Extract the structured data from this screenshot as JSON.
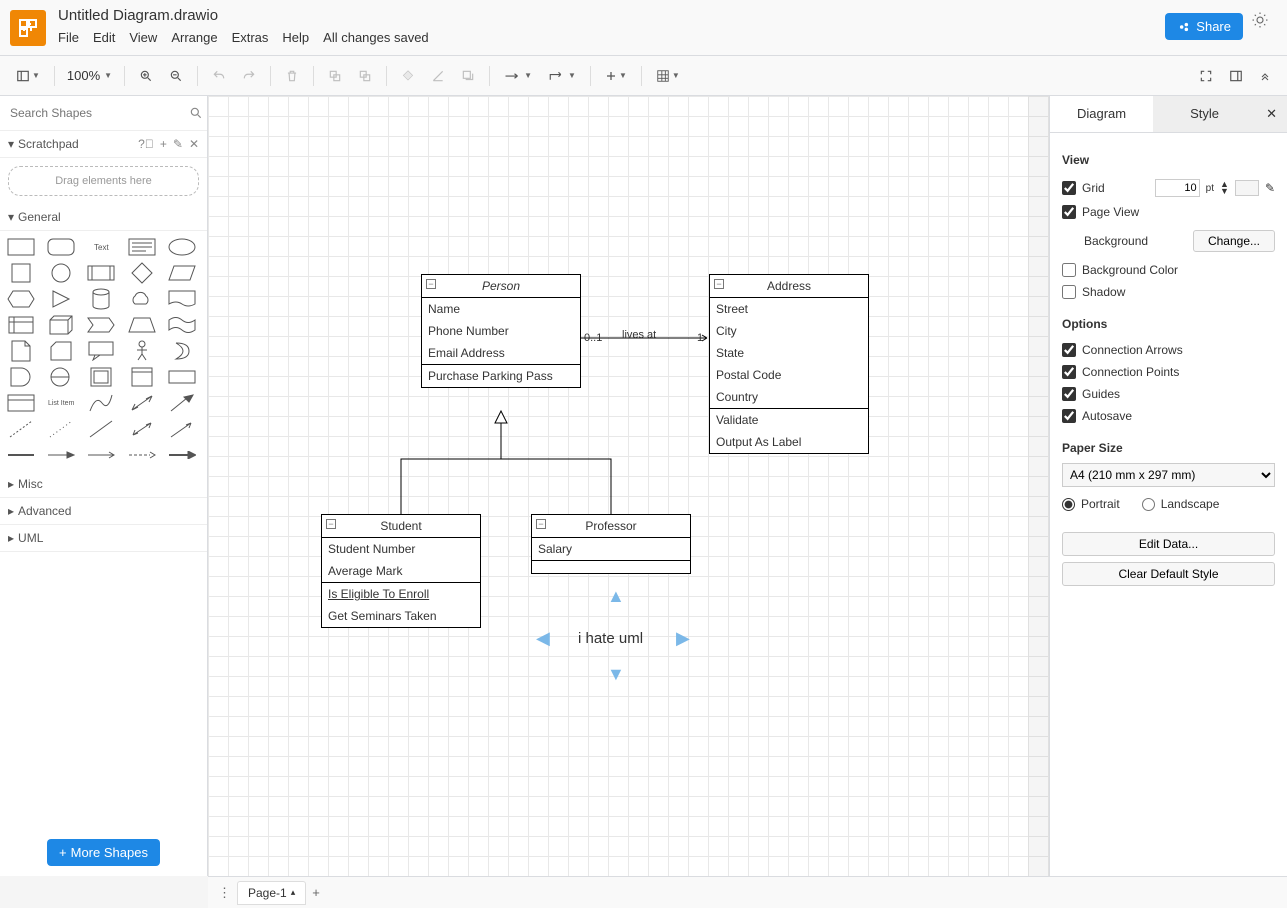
{
  "doc_title": "Untitled Diagram.drawio",
  "menu": [
    "File",
    "Edit",
    "View",
    "Arrange",
    "Extras",
    "Help"
  ],
  "save_status": "All changes saved",
  "share": "Share",
  "zoom": "100%",
  "search_placeholder": "Search Shapes",
  "scratchpad": {
    "label": "Scratchpad",
    "dropzone": "Drag elements here"
  },
  "sections": {
    "general": "General",
    "misc": "Misc",
    "advanced": "Advanced",
    "uml": "UML"
  },
  "more_shapes": "More Shapes",
  "page_tab": "Page-1",
  "uml": {
    "person": {
      "title": "Person",
      "attrs": [
        "Name",
        "Phone Number",
        "Email Address"
      ],
      "ops": [
        "Purchase Parking Pass"
      ]
    },
    "address": {
      "title": "Address",
      "attrs": [
        "Street",
        "City",
        "State",
        "Postal Code",
        "Country"
      ],
      "ops": [
        "Validate",
        "Output As Label"
      ]
    },
    "student": {
      "title": "Student",
      "attrs": [
        "Student Number",
        "Average Mark"
      ],
      "ops": [
        "Is Eligible To Enroll",
        "Get Seminars Taken"
      ]
    },
    "professor": {
      "title": "Professor",
      "attrs": [
        "Salary"
      ]
    },
    "assoc": {
      "label": "lives at",
      "left": "0..1",
      "right": "1"
    },
    "free_text": "i hate uml"
  },
  "panel": {
    "tabs": {
      "diagram": "Diagram",
      "style": "Style"
    },
    "view": {
      "title": "View",
      "grid": "Grid",
      "grid_val": "10",
      "grid_unit": "pt",
      "page_view": "Page View",
      "background": "Background",
      "change": "Change...",
      "bg_color": "Background Color",
      "shadow": "Shadow"
    },
    "options": {
      "title": "Options",
      "conn_arrows": "Connection Arrows",
      "conn_points": "Connection Points",
      "guides": "Guides",
      "autosave": "Autosave"
    },
    "paper": {
      "title": "Paper Size",
      "size": "A4 (210 mm x 297 mm)",
      "portrait": "Portrait",
      "landscape": "Landscape"
    },
    "edit_data": "Edit Data...",
    "clear_style": "Clear Default Style"
  }
}
